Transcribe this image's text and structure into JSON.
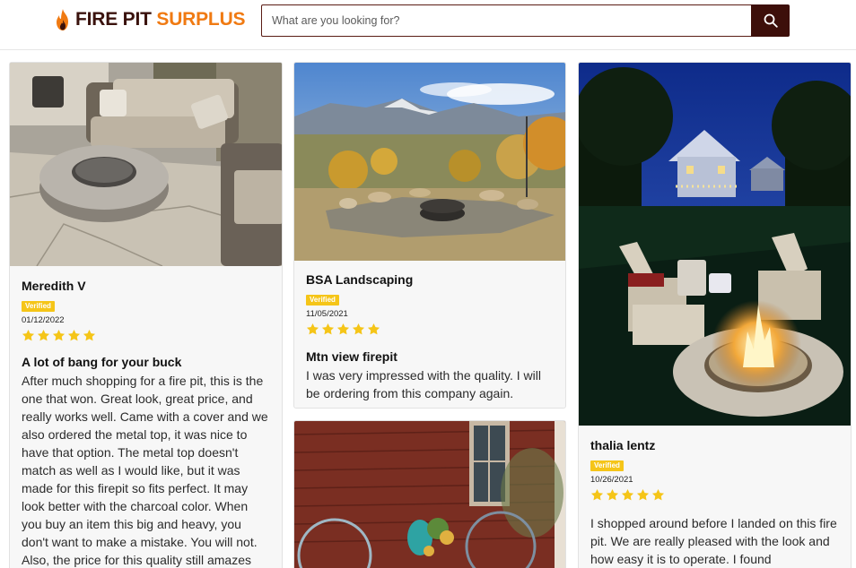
{
  "header": {
    "logo_fire": "FIRE PIT",
    "logo_surplus": "SURPLUS",
    "search_placeholder": "What are you looking for?"
  },
  "reviews": [
    {
      "author": "Meredith V",
      "badge": "Verified",
      "date": "01/12/2022",
      "rating": 5,
      "title": "A lot of bang for your buck",
      "text": "After much shopping for a fire pit, this is the one that won. Great look, great price, and really works well. Came with a cover and we also ordered the metal top, it was nice to have that option. The metal top doesn't match as well as I would like, but it was made for this firepit so fits perfect. It may look better with the charcoal color. When you buy an item this big and heavy, you don't want to make a mistake. You will not. Also, the price for this quality still amazes"
    },
    {
      "author": "BSA Landscaping",
      "badge": "Verified",
      "date": "11/05/2021",
      "rating": 5,
      "title": "Mtn view firepit",
      "text": "I was very impressed with the quality. I will be ordering from this company again."
    },
    {
      "author": "thalia lentz",
      "badge": "Verified",
      "date": "10/26/2021",
      "rating": 5,
      "title": "",
      "text": "I shopped around before I landed on this fire pit. We are really pleased with the look and how easy it is to operate. I found"
    }
  ],
  "colors": {
    "brand_dark": "#3a120d",
    "brand_orange": "#f07a12",
    "star": "#f5c518",
    "badge": "#f5c518"
  },
  "icons": {
    "logo": "flame-icon",
    "search": "search-icon",
    "rating": "star-icon"
  }
}
